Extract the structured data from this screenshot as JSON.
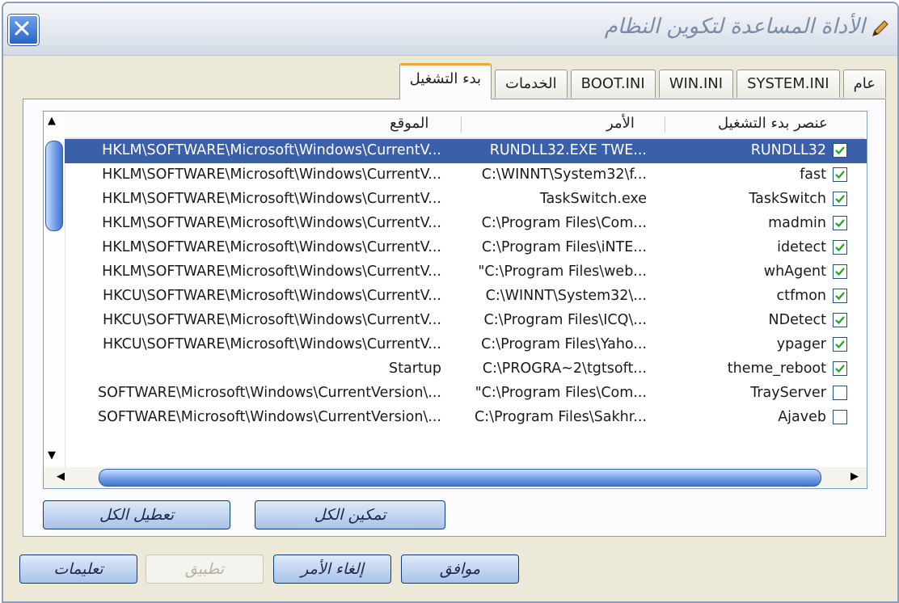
{
  "window": {
    "title": "الأداة المساعدة لتكوين النظام"
  },
  "tabs": [
    {
      "label": "عام",
      "active": false
    },
    {
      "label": "SYSTEM.INI",
      "active": false
    },
    {
      "label": "WIN.INI",
      "active": false
    },
    {
      "label": "BOOT.INI",
      "active": false
    },
    {
      "label": "الخدمات",
      "active": false
    },
    {
      "label": "بدء التشغيل",
      "active": true
    }
  ],
  "columns": {
    "name": "عنصر بدء التشغيل",
    "command": "الأمر",
    "location": "الموقع"
  },
  "rows": [
    {
      "name": "RUNDLL32",
      "command": "RUNDLL32.EXE TWE...",
      "location": "HKLM\\SOFTWARE\\Microsoft\\Windows\\CurrentV...",
      "checked": true,
      "selected": true
    },
    {
      "name": "fast",
      "command": "C:\\WINNT\\System32\\f...",
      "location": "HKLM\\SOFTWARE\\Microsoft\\Windows\\CurrentV...",
      "checked": true,
      "selected": false
    },
    {
      "name": "TaskSwitch",
      "command": "TaskSwitch.exe",
      "location": "HKLM\\SOFTWARE\\Microsoft\\Windows\\CurrentV...",
      "checked": true,
      "selected": false
    },
    {
      "name": "madmin",
      "command": "C:\\Program Files\\Com...",
      "location": "HKLM\\SOFTWARE\\Microsoft\\Windows\\CurrentV...",
      "checked": true,
      "selected": false
    },
    {
      "name": "idetect",
      "command": "C:\\Program Files\\iNTE...",
      "location": "HKLM\\SOFTWARE\\Microsoft\\Windows\\CurrentV...",
      "checked": true,
      "selected": false
    },
    {
      "name": "whAgent",
      "command": "\"C:\\Program Files\\web...",
      "location": "HKLM\\SOFTWARE\\Microsoft\\Windows\\CurrentV...",
      "checked": true,
      "selected": false
    },
    {
      "name": "ctfmon",
      "command": "C:\\WINNT\\System32\\...",
      "location": "HKCU\\SOFTWARE\\Microsoft\\Windows\\CurrentV...",
      "checked": true,
      "selected": false
    },
    {
      "name": "NDetect",
      "command": "C:\\Program Files\\ICQ\\...",
      "location": "HKCU\\SOFTWARE\\Microsoft\\Windows\\CurrentV...",
      "checked": true,
      "selected": false
    },
    {
      "name": "ypager",
      "command": "C:\\Program Files\\Yaho...",
      "location": "HKCU\\SOFTWARE\\Microsoft\\Windows\\CurrentV...",
      "checked": true,
      "selected": false
    },
    {
      "name": "theme_reboot",
      "command": "C:\\PROGRA~2\\tgtsoft...",
      "location": "Startup",
      "checked": true,
      "selected": false
    },
    {
      "name": "TrayServer",
      "command": "\"C:\\Program Files\\Com...",
      "location": "SOFTWARE\\Microsoft\\Windows\\CurrentVersion\\...",
      "checked": false,
      "selected": false
    },
    {
      "name": "Ajaveb",
      "command": "C:\\Program Files\\Sakhr...",
      "location": "SOFTWARE\\Microsoft\\Windows\\CurrentVersion\\...",
      "checked": false,
      "selected": false
    }
  ],
  "buttons": {
    "enable_all": "تمكين الكل",
    "disable_all": "تعطيل الكل",
    "ok": "موافق",
    "cancel": "إلغاء الأمر",
    "apply": "تطبيق",
    "help": "تعليمات"
  },
  "icons": {
    "close": "close-x-icon",
    "app": "pencil-tool-icon",
    "checkbox": "checkmark-icon"
  },
  "colors": {
    "selection": "#3b5fa8",
    "button_border": "#0f3c7a",
    "tab_highlight": "#f2a43a"
  }
}
